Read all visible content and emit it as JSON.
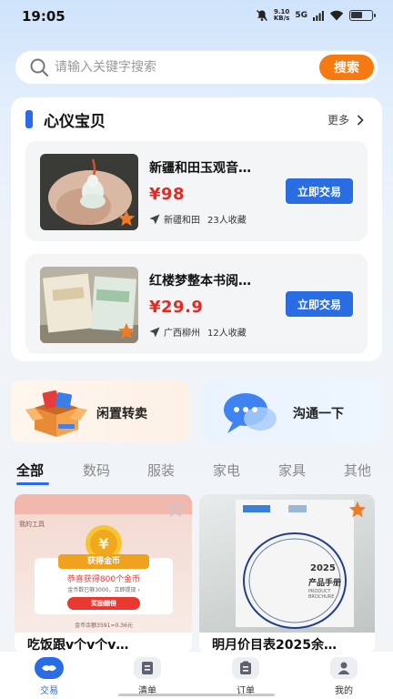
{
  "status_bar": {
    "time": "19:05",
    "speed_value": "9.10",
    "speed_unit": "KB/s",
    "network": "5G"
  },
  "search": {
    "placeholder": "请输入关键字搜索",
    "button_label": "搜索"
  },
  "section": {
    "title": "心仪宝贝",
    "more_label": "更多",
    "products": [
      {
        "title": "新疆和田玉观音…",
        "price": "¥98",
        "location": "新疆和田",
        "favorites": "23人收藏",
        "button_label": "立即交易"
      },
      {
        "title": "红楼梦整本书阅…",
        "price": "¥29.9",
        "location": "广西柳州",
        "favorites": "12人收藏",
        "button_label": "立即交易"
      }
    ]
  },
  "quick_entries": {
    "resale_label": "闲置转卖",
    "chat_label": "沟通一下"
  },
  "tabs": [
    "全部",
    "数码",
    "服装",
    "家电",
    "家具",
    "其他"
  ],
  "active_tab": "全部",
  "feed": [
    {
      "title": "吃饭跟v个v个v…",
      "banner_title": "获得金币",
      "banner_text": "恭喜获得800个金币",
      "banner_sub": "金币数已够3000，立即提现 ›",
      "banner_button": "奖励翻倍",
      "banner_footer": "金币余额3591≈0.36元",
      "banner_header": "我的工具"
    },
    {
      "title": "明月价目表2025余…",
      "image_text_year": "2025",
      "image_text_title": "产品手册",
      "image_text_sub": "PRODUCT BROCHURE"
    }
  ],
  "bottom_nav": [
    {
      "label": "交易",
      "active": true
    },
    {
      "label": "清单",
      "active": false
    },
    {
      "label": "订单",
      "active": false
    },
    {
      "label": "我的",
      "active": false
    }
  ],
  "colors": {
    "accent": "#2b6ce6",
    "search_button": "#f57a12",
    "price": "#e12b25"
  }
}
